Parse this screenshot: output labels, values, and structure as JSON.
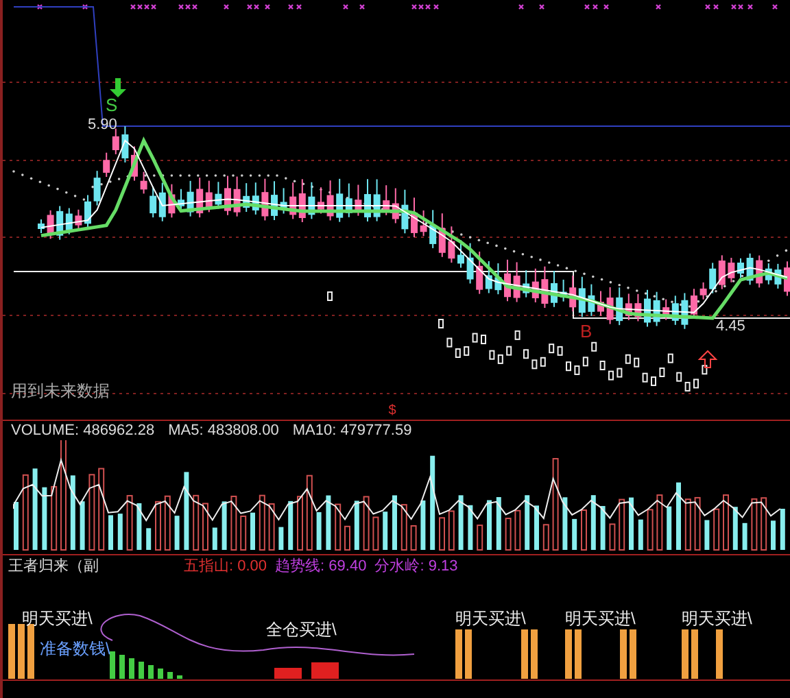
{
  "price_panel": {
    "price_labels": [
      {
        "kind": "high",
        "text": "5.90"
      },
      {
        "kind": "low",
        "text": "4.45"
      }
    ],
    "signals": [
      {
        "kind": "sell",
        "label": "S"
      },
      {
        "kind": "buy",
        "label": "B"
      }
    ],
    "note": "用到未来数据",
    "marker": "$"
  },
  "volume_panel": {
    "readings": [
      {
        "label": "VOLUME:",
        "value": "486962.28"
      },
      {
        "label": "MA5:",
        "value": "483808.00"
      },
      {
        "label": "MA10:",
        "value": "479777.59"
      }
    ]
  },
  "indicator_panel": {
    "title": "王者归来（副",
    "readings": [
      {
        "label": "五指山:",
        "value": "0.00",
        "color": "#e03030"
      },
      {
        "label": "趋势线:",
        "value": "69.40",
        "color": "#c040e0"
      },
      {
        "label": "分水岭:",
        "value": "9.13",
        "color": "#c040e0"
      }
    ],
    "signals": [
      {
        "kind": "tomorrow",
        "text": "明天买进\\"
      },
      {
        "kind": "ready",
        "text": "准备数钱\\"
      },
      {
        "kind": "full",
        "text": "全仓买进\\"
      },
      {
        "kind": "tomorrow",
        "text": "明天买进\\"
      },
      {
        "kind": "tomorrow",
        "text": "明天买进\\"
      },
      {
        "kind": "tomorrow",
        "text": "明天买进\\"
      }
    ]
  }
}
